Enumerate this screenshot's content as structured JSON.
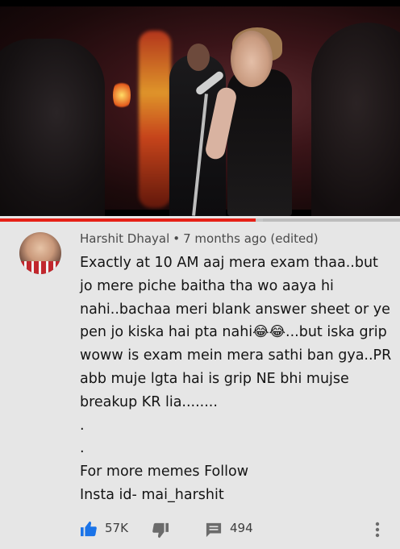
{
  "video": {
    "progress_percent": 64,
    "buffer_percent": 35,
    "colors": {
      "progress": "#e62117",
      "track": "#bdbdbd"
    }
  },
  "comment": {
    "author": "Harshit Dhayal",
    "separator": "•",
    "time": "7 months ago (edited)",
    "lines": [
      "Exactly at 10 AM aaj mera exam thaa..but",
      "jo mere piche baitha tha wo aaya hi",
      "nahi..bachaa meri blank answer sheet or ye",
      "pen jo kiska hai pta nahi😂😂...but iska grip",
      "woww is exam mein mera sathi ban gya..PR",
      "abb muje lgta hai is grip NE bhi mujse",
      "breakup KR lia........",
      ".",
      ".",
      "For more memes Follow",
      "Insta id- mai_harshit"
    ],
    "likes": "57K",
    "replies": "494",
    "icons": {
      "like": "thumbs-up-icon",
      "dislike": "thumbs-down-icon",
      "reply": "comment-icon",
      "more": "more-vert-icon"
    },
    "colors": {
      "like_active": "#1a73e8",
      "icon": "#6b6b6b"
    }
  }
}
